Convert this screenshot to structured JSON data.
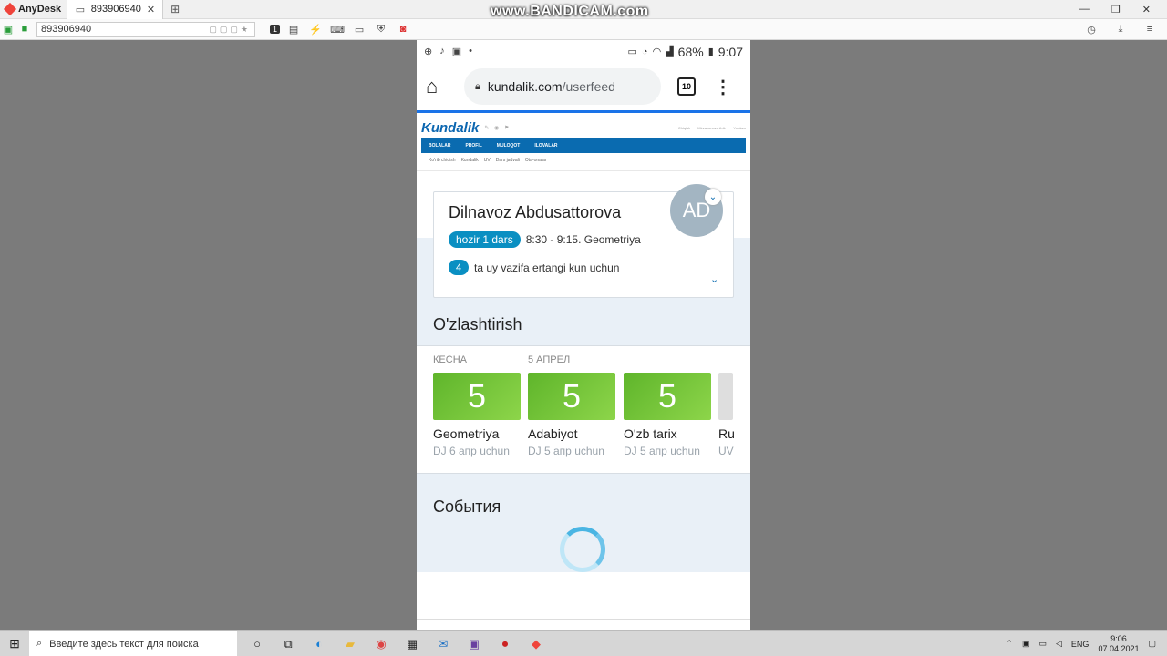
{
  "anydesk": {
    "app_name": "AnyDesk",
    "tab_title": "893906940",
    "address": "893906940",
    "monitor_number": "1"
  },
  "overlay": {
    "watermark": "www.BANDICAM.com"
  },
  "phone": {
    "status": {
      "battery": "68%",
      "time": "9:07"
    },
    "browser": {
      "url_domain": "kundalik.com",
      "url_path": "/userfeed",
      "tab_count": "10"
    },
    "kundalik": {
      "logo": "Kundalik",
      "nav": [
        "BOLALAR",
        "PROFIL",
        "MULOQOT",
        "ILOVALAR"
      ],
      "subnav": [
        "Ko'rib chiqish",
        "Kundalik",
        "UV",
        "Dars jadvali",
        "Ota-onalar"
      ],
      "top_right": [
        "Chiqish",
        "Mirzaxonova A.A.",
        "Yordam"
      ]
    },
    "card": {
      "name": "Dilnavoz Abdusattorova",
      "avatar": "AD",
      "lesson_badge": "hozir 1 dars",
      "lesson_text": "8:30 - 9:15. Geometriya",
      "hw_count": "4",
      "hw_text": "ta uy vazifa ertangi kun uchun"
    },
    "progress": {
      "title": "O'zlashtirish",
      "date_labels": [
        "КЕСНА",
        "5 АПРЕЛ"
      ],
      "grades": [
        {
          "value": "5",
          "subject": "Geometriya",
          "note": "DJ 6 апр uchun"
        },
        {
          "value": "5",
          "subject": "Adabiyot",
          "note": "DJ 5 апр uchun"
        },
        {
          "value": "5",
          "subject": "O'zb tarix",
          "note": "DJ 5 апр uchun"
        },
        {
          "value": "",
          "subject": "Ru",
          "note": "UV"
        }
      ]
    },
    "events": {
      "title": "События"
    }
  },
  "taskbar": {
    "search_placeholder": "Введите здесь текст для поиска",
    "lang": "ENG",
    "time": "9:06",
    "date": "07.04.2021"
  }
}
